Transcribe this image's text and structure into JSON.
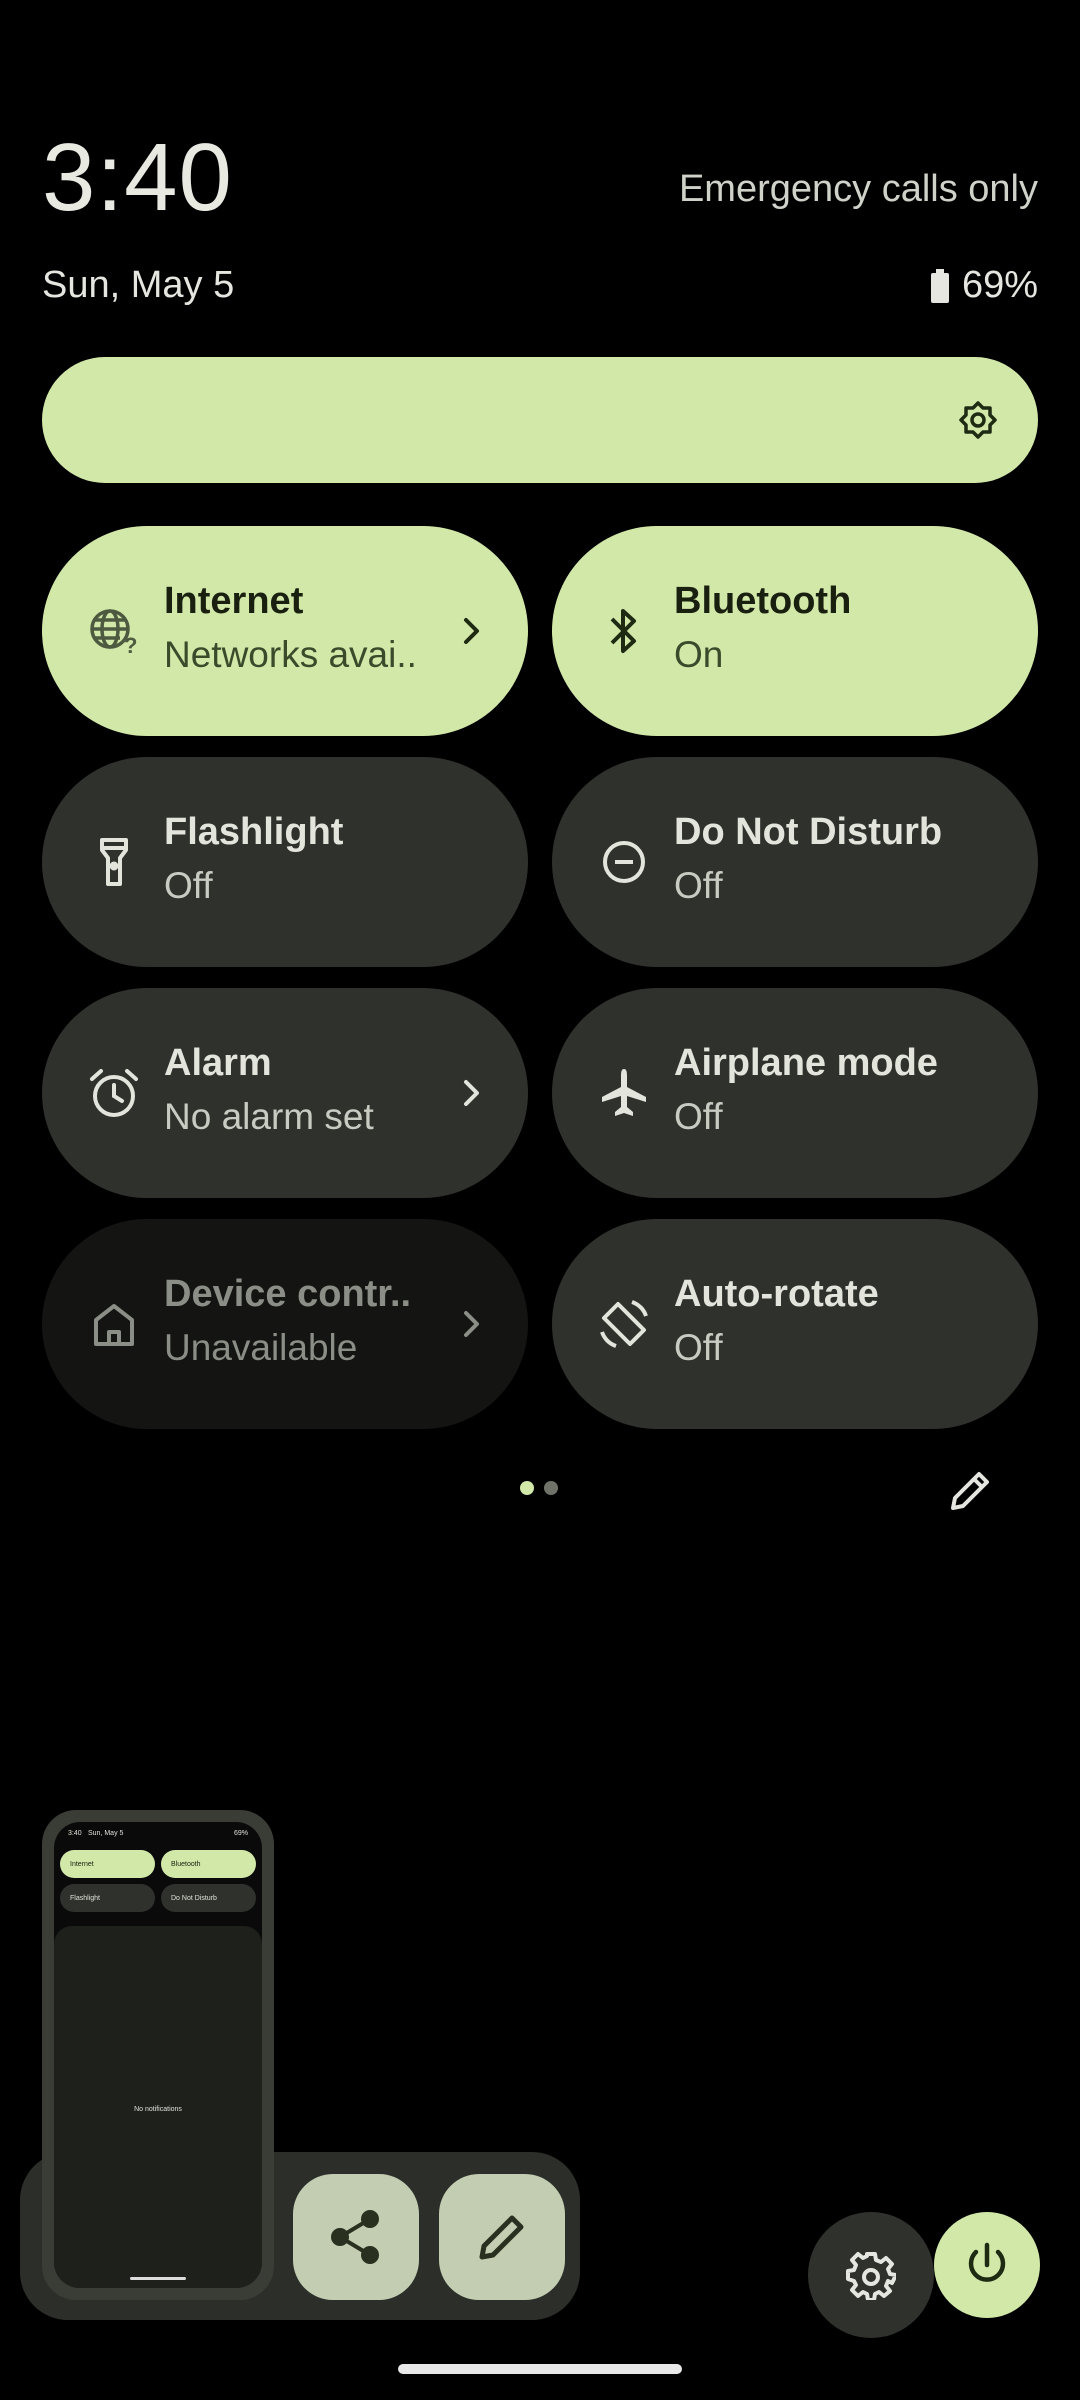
{
  "status": {
    "time": "3:40",
    "date": "Sun, May 5",
    "carrier": "Emergency calls only",
    "battery_percent": "69%"
  },
  "brightness": {
    "icon": "brightness-icon"
  },
  "tiles": [
    {
      "title": "Internet",
      "subtitle": "Networks avai..",
      "state": "on",
      "icon": "globe-question-icon",
      "has_chevron": true
    },
    {
      "title": "Bluetooth",
      "subtitle": "On",
      "state": "on",
      "icon": "bluetooth-icon",
      "has_chevron": false
    },
    {
      "title": "Flashlight",
      "subtitle": "Off",
      "state": "off",
      "icon": "flashlight-icon",
      "has_chevron": false
    },
    {
      "title": "Do Not Disturb",
      "subtitle": "Off",
      "state": "off",
      "icon": "do-not-disturb-icon",
      "has_chevron": false
    },
    {
      "title": "Alarm",
      "subtitle": "No alarm set",
      "state": "off",
      "icon": "alarm-icon",
      "has_chevron": true
    },
    {
      "title": "Airplane mode",
      "subtitle": "Off",
      "state": "off",
      "icon": "airplane-icon",
      "has_chevron": false
    },
    {
      "title": "Device contr..",
      "subtitle": "Unavailable",
      "state": "disabled",
      "icon": "home-icon",
      "has_chevron": true
    },
    {
      "title": "Auto-rotate",
      "subtitle": "Off",
      "state": "off",
      "icon": "auto-rotate-icon",
      "has_chevron": false
    }
  ],
  "pager": {
    "pages": 2,
    "current": 1
  },
  "screenshot_preview": {
    "time": "3:40",
    "date": "Sun, May 5",
    "battery": "69%",
    "tiles": [
      "Internet",
      "Bluetooth",
      "Flashlight",
      "Do Not Disturb"
    ],
    "empty_text": "No notifications"
  },
  "colors": {
    "accent": "#d1e8a8",
    "tile_off": "#2f312c",
    "tile_disabled": "#141512",
    "background": "#000000"
  }
}
